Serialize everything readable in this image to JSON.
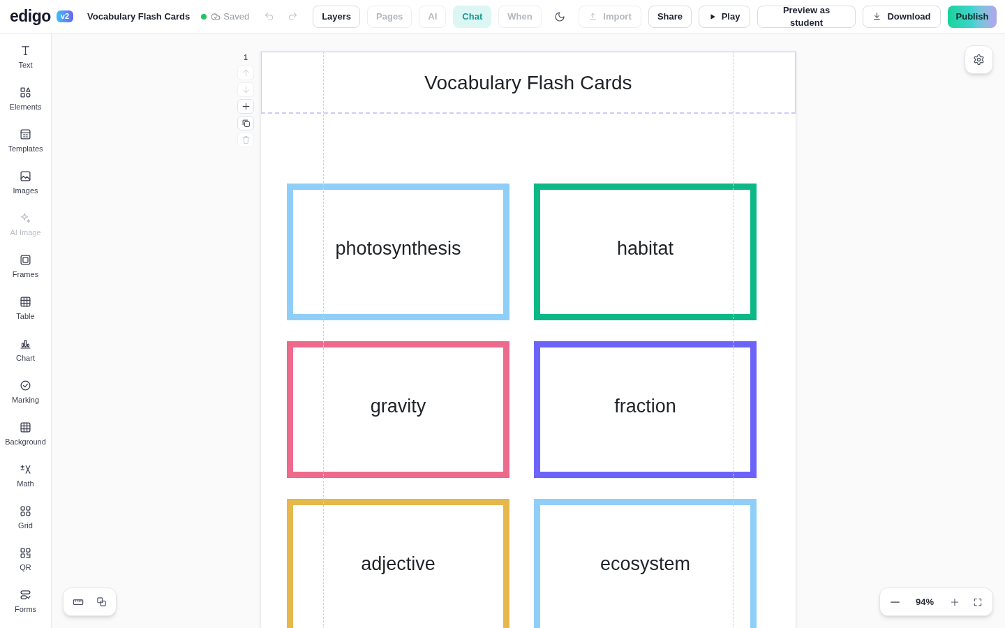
{
  "header": {
    "logo": "edigo",
    "version_badge": "v2",
    "document_title": "Vocabulary Flash Cards",
    "save_status": "Saved"
  },
  "history": [
    {
      "kind": "undo",
      "disabled": true
    },
    {
      "kind": "redo",
      "disabled": true
    }
  ],
  "view_tabs": [
    {
      "label": "Layers",
      "selected": false,
      "disabled": false
    },
    {
      "label": "Pages",
      "selected": false,
      "disabled": true
    },
    {
      "label": "AI",
      "selected": false,
      "disabled": true
    },
    {
      "label": "Chat",
      "selected": true,
      "disabled": false
    },
    {
      "label": "When",
      "selected": false,
      "disabled": true
    }
  ],
  "actions": [
    {
      "kind": "theme",
      "disabled": false
    },
    {
      "kind": "import",
      "label": "Import",
      "disabled": true
    },
    {
      "kind": "share",
      "label": "Share",
      "disabled": false
    },
    {
      "kind": "play",
      "label": "Play",
      "disabled": false
    },
    {
      "kind": "preview",
      "label": "Preview as student",
      "disabled": false
    },
    {
      "kind": "download",
      "label": "Download",
      "disabled": false
    },
    {
      "kind": "publish",
      "label": "Publish",
      "disabled": false
    }
  ],
  "sidebar": {
    "items": [
      {
        "kind": "text",
        "label": "Text",
        "disabled": false
      },
      {
        "kind": "elements",
        "label": "Elements",
        "disabled": false
      },
      {
        "kind": "templates",
        "label": "Templates",
        "disabled": false
      },
      {
        "kind": "images",
        "label": "Images",
        "disabled": false
      },
      {
        "kind": "aiimage",
        "label": "AI Image",
        "disabled": true
      },
      {
        "kind": "frames",
        "label": "Frames",
        "disabled": false
      },
      {
        "kind": "table",
        "label": "Table",
        "disabled": false
      },
      {
        "kind": "chart",
        "label": "Chart",
        "disabled": false
      },
      {
        "kind": "marking",
        "label": "Marking",
        "disabled": false
      },
      {
        "kind": "background",
        "label": "Background",
        "disabled": false
      },
      {
        "kind": "math",
        "label": "Math",
        "disabled": false
      },
      {
        "kind": "grid",
        "label": "Grid",
        "disabled": false
      },
      {
        "kind": "qr",
        "label": "QR",
        "disabled": false
      },
      {
        "kind": "forms",
        "label": "Forms",
        "disabled": false
      }
    ]
  },
  "page": {
    "number": "1",
    "controls": [
      {
        "kind": "up",
        "disabled": true
      },
      {
        "kind": "down",
        "disabled": true
      },
      {
        "kind": "add",
        "disabled": false
      },
      {
        "kind": "duplicate",
        "disabled": false
      },
      {
        "kind": "delete",
        "disabled": true
      }
    ],
    "title": {
      "text": "Vocabulary Flash Cards",
      "selected": true
    },
    "cards": [
      {
        "word": "photosynthesis",
        "color": "#90cefa"
      },
      {
        "word": "habitat",
        "color": "#0cb886"
      },
      {
        "word": "gravity",
        "color": "#ee6a8c"
      },
      {
        "word": "fraction",
        "color": "#6c63fb"
      },
      {
        "word": "adjective",
        "color": "#e6b84b"
      },
      {
        "word": "ecosystem",
        "color": "#90cefa"
      }
    ]
  },
  "zoom": {
    "value": "94%"
  }
}
